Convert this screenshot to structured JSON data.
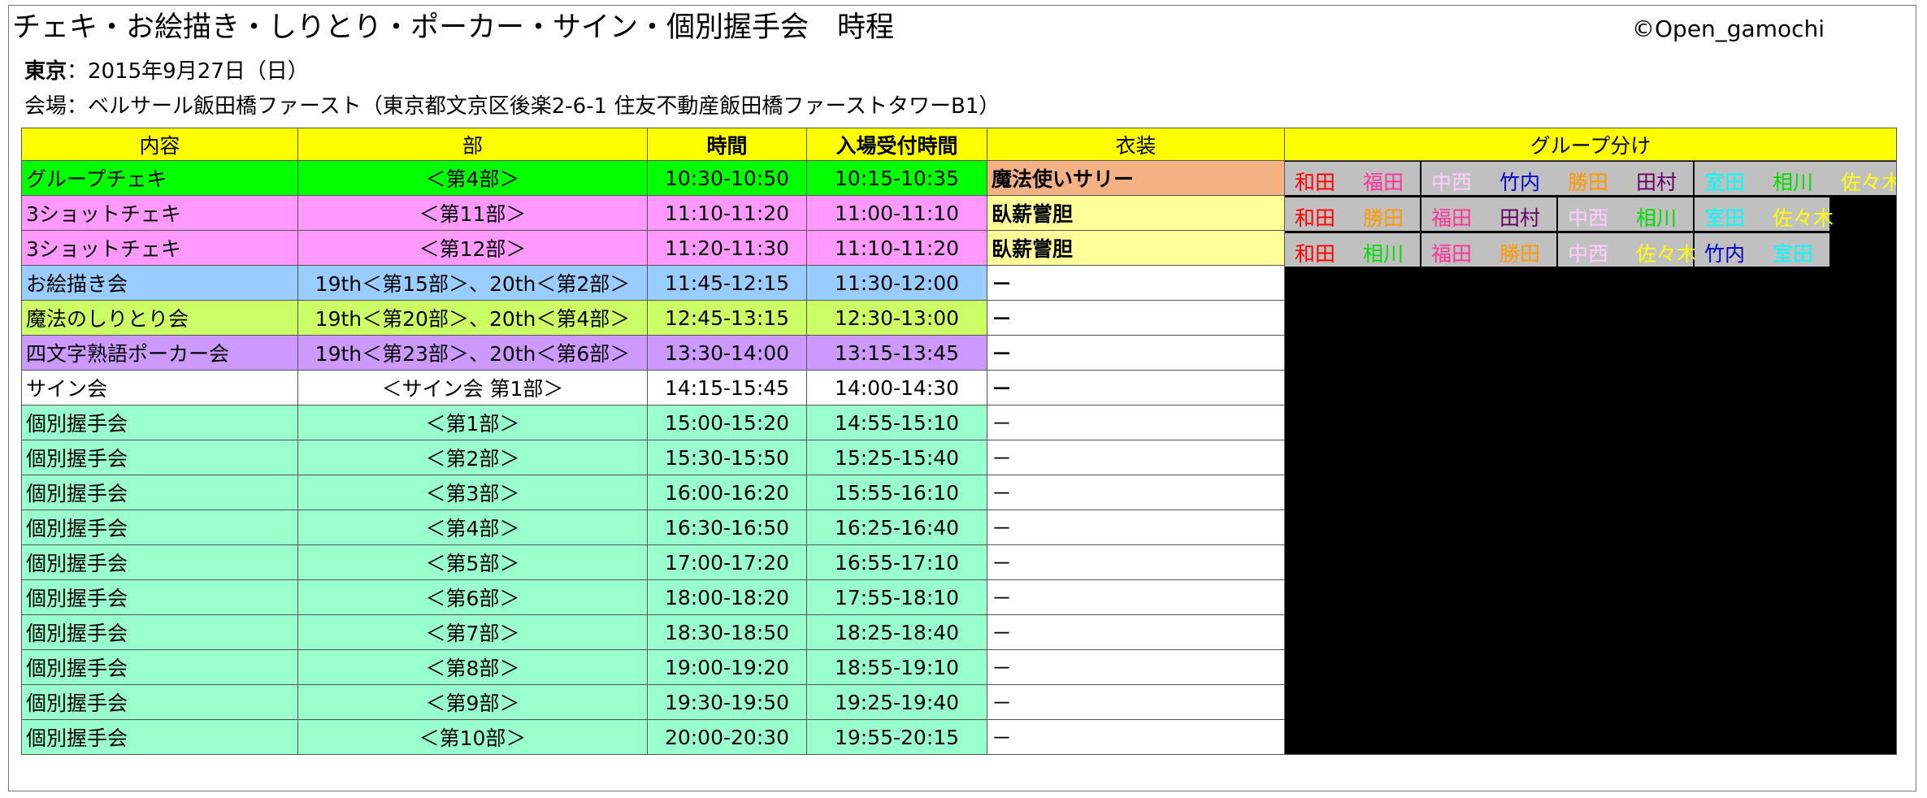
{
  "title": "チェキ・お絵描き・しりとり・ポーカー・サイン・個別握手会　時程",
  "credit": "©Open_gamochi",
  "date": {
    "label": "東京",
    "value": "：2015年9月27日（日）"
  },
  "venue": "会場：ベルサール飯田橋ファースト（東京都文京区後楽2-6-1 住友不動産飯田橋ファーストタワーB1）",
  "headers": {
    "content": "内容",
    "part": "部",
    "time": "時間",
    "entry": "入場受付時間",
    "costume": "衣装",
    "group": "グループ分け"
  },
  "colors": {
    "header": "#ffff00",
    "cheki": "#00ff00",
    "three_shot": "#ff99ff",
    "oekaki": "#99ccff",
    "shiritori": "#ccff66",
    "poker": "#cc99ff",
    "sign": "#ffffff",
    "handshake": "#99ffcc",
    "costume_sally": "#f4b183",
    "costume_pale": "#ffff99",
    "group_box": "#c0c0c0"
  },
  "rows": [
    {
      "content": "グループチェキ",
      "part": "＜第4部＞",
      "time": "10:30-10:50",
      "entry": "10:15-10:35",
      "costume": "魔法使いサリー",
      "bg": "#00ff00",
      "costume_bg": "#f4b183",
      "costume_bold": true
    },
    {
      "content": "3ショットチェキ",
      "part": "＜第11部＞",
      "time": "11:10-11:20",
      "entry": "11:00-11:10",
      "costume": "臥薪嘗胆",
      "bg": "#ff99ff",
      "costume_bg": "#ffff99",
      "costume_bold": true
    },
    {
      "content": "3ショットチェキ",
      "part": "＜第12部＞",
      "time": "11:20-11:30",
      "entry": "11:10-11:20",
      "costume": "臥薪嘗胆",
      "bg": "#ff99ff",
      "costume_bg": "#ffff99",
      "costume_bold": true
    },
    {
      "content": "お絵描き会",
      "part": "19th＜第15部＞、20th＜第2部＞",
      "time": "11:45-12:15",
      "entry": "11:30-12:00",
      "costume": "－",
      "bg": "#99ccff",
      "costume_bg": "#ffffff",
      "costume_bold": true
    },
    {
      "content": "魔法のしりとり会",
      "part": "19th＜第20部＞、20th＜第4部＞",
      "time": "12:45-13:15",
      "entry": "12:30-13:00",
      "costume": "－",
      "bg": "#ccff66",
      "costume_bg": "#ffffff",
      "costume_bold": true
    },
    {
      "content": "四文字熟語ポーカー会",
      "part": "19th＜第23部＞、20th＜第6部＞",
      "time": "13:30-14:00",
      "entry": "13:15-13:45",
      "costume": "－",
      "bg": "#cc99ff",
      "costume_bg": "#ffffff",
      "costume_bold": true
    },
    {
      "content": "サイン会",
      "part": "＜サイン会 第1部＞",
      "time": "14:15-15:45",
      "entry": "14:00-14:30",
      "costume": "－",
      "bg": "#ffffff",
      "costume_bg": "#ffffff",
      "costume_bold": true
    },
    {
      "content": "個別握手会",
      "part": "＜第1部＞",
      "time": "15:00-15:20",
      "entry": "14:55-15:10",
      "costume": "－",
      "bg": "#99ffcc",
      "costume_bg": "#ffffff",
      "costume_bold": false
    },
    {
      "content": "個別握手会",
      "part": "＜第2部＞",
      "time": "15:30-15:50",
      "entry": "15:25-15:40",
      "costume": "－",
      "bg": "#99ffcc",
      "costume_bg": "#ffffff",
      "costume_bold": false
    },
    {
      "content": "個別握手会",
      "part": "＜第3部＞",
      "time": "16:00-16:20",
      "entry": "15:55-16:10",
      "costume": "－",
      "bg": "#99ffcc",
      "costume_bg": "#ffffff",
      "costume_bold": false
    },
    {
      "content": "個別握手会",
      "part": "＜第4部＞",
      "time": "16:30-16:50",
      "entry": "16:25-16:40",
      "costume": "－",
      "bg": "#99ffcc",
      "costume_bg": "#ffffff",
      "costume_bold": false
    },
    {
      "content": "個別握手会",
      "part": "＜第5部＞",
      "time": "17:00-17:20",
      "entry": "16:55-17:10",
      "costume": "－",
      "bg": "#99ffcc",
      "costume_bg": "#ffffff",
      "costume_bold": false
    },
    {
      "content": "個別握手会",
      "part": "＜第6部＞",
      "time": "18:00-18:20",
      "entry": "17:55-18:10",
      "costume": "－",
      "bg": "#99ffcc",
      "costume_bg": "#ffffff",
      "costume_bold": false
    },
    {
      "content": "個別握手会",
      "part": "＜第7部＞",
      "time": "18:30-18:50",
      "entry": "18:25-18:40",
      "costume": "－",
      "bg": "#99ffcc",
      "costume_bg": "#ffffff",
      "costume_bold": false
    },
    {
      "content": "個別握手会",
      "part": "＜第8部＞",
      "time": "19:00-19:20",
      "entry": "18:55-19:10",
      "costume": "－",
      "bg": "#99ffcc",
      "costume_bg": "#ffffff",
      "costume_bold": false
    },
    {
      "content": "個別握手会",
      "part": "＜第9部＞",
      "time": "19:30-19:50",
      "entry": "19:25-19:40",
      "costume": "－",
      "bg": "#99ffcc",
      "costume_bg": "#ffffff",
      "costume_bold": false
    },
    {
      "content": "個別握手会",
      "part": "＜第10部＞",
      "time": "20:00-20:30",
      "entry": "19:55-20:15",
      "costume": "－",
      "bg": "#99ffcc",
      "costume_bg": "#ffffff",
      "costume_bold": false
    }
  ],
  "groups": [
    [
      [
        {
          "name": "和田",
          "color": "#ff0000"
        },
        {
          "name": "福田",
          "color": "#ff3399"
        }
      ],
      [
        {
          "name": "中西",
          "color": "#ffccff"
        },
        {
          "name": "竹内",
          "color": "#0000cc"
        },
        {
          "name": "勝田",
          "color": "#ff9900"
        },
        {
          "name": "田村",
          "color": "#660066"
        }
      ],
      [
        {
          "name": "室田",
          "color": "#00ffff"
        },
        {
          "name": "相川",
          "color": "#00dd00"
        },
        {
          "name": "佐々木",
          "color": "#ffff00"
        }
      ]
    ],
    [
      [
        {
          "name": "和田",
          "color": "#ff0000"
        },
        {
          "name": "勝田",
          "color": "#ff9900"
        }
      ],
      [
        {
          "name": "福田",
          "color": "#ff3399"
        },
        {
          "name": "田村",
          "color": "#660066"
        }
      ],
      [
        {
          "name": "中西",
          "color": "#ffccff"
        },
        {
          "name": "相川",
          "color": "#00dd00"
        }
      ],
      [
        {
          "name": "室田",
          "color": "#00ffff"
        },
        {
          "name": "佐々木",
          "color": "#ffff00"
        }
      ]
    ],
    [
      [
        {
          "name": "和田",
          "color": "#ff0000"
        },
        {
          "name": "相川",
          "color": "#00dd00"
        }
      ],
      [
        {
          "name": "福田",
          "color": "#ff3399"
        },
        {
          "name": "勝田",
          "color": "#ff9900"
        }
      ],
      [
        {
          "name": "中西",
          "color": "#ffccff"
        },
        {
          "name": "佐々木",
          "color": "#ffff00"
        }
      ],
      [
        {
          "name": "竹内",
          "color": "#0000cc"
        },
        {
          "name": "室田",
          "color": "#00ffff"
        }
      ]
    ]
  ]
}
